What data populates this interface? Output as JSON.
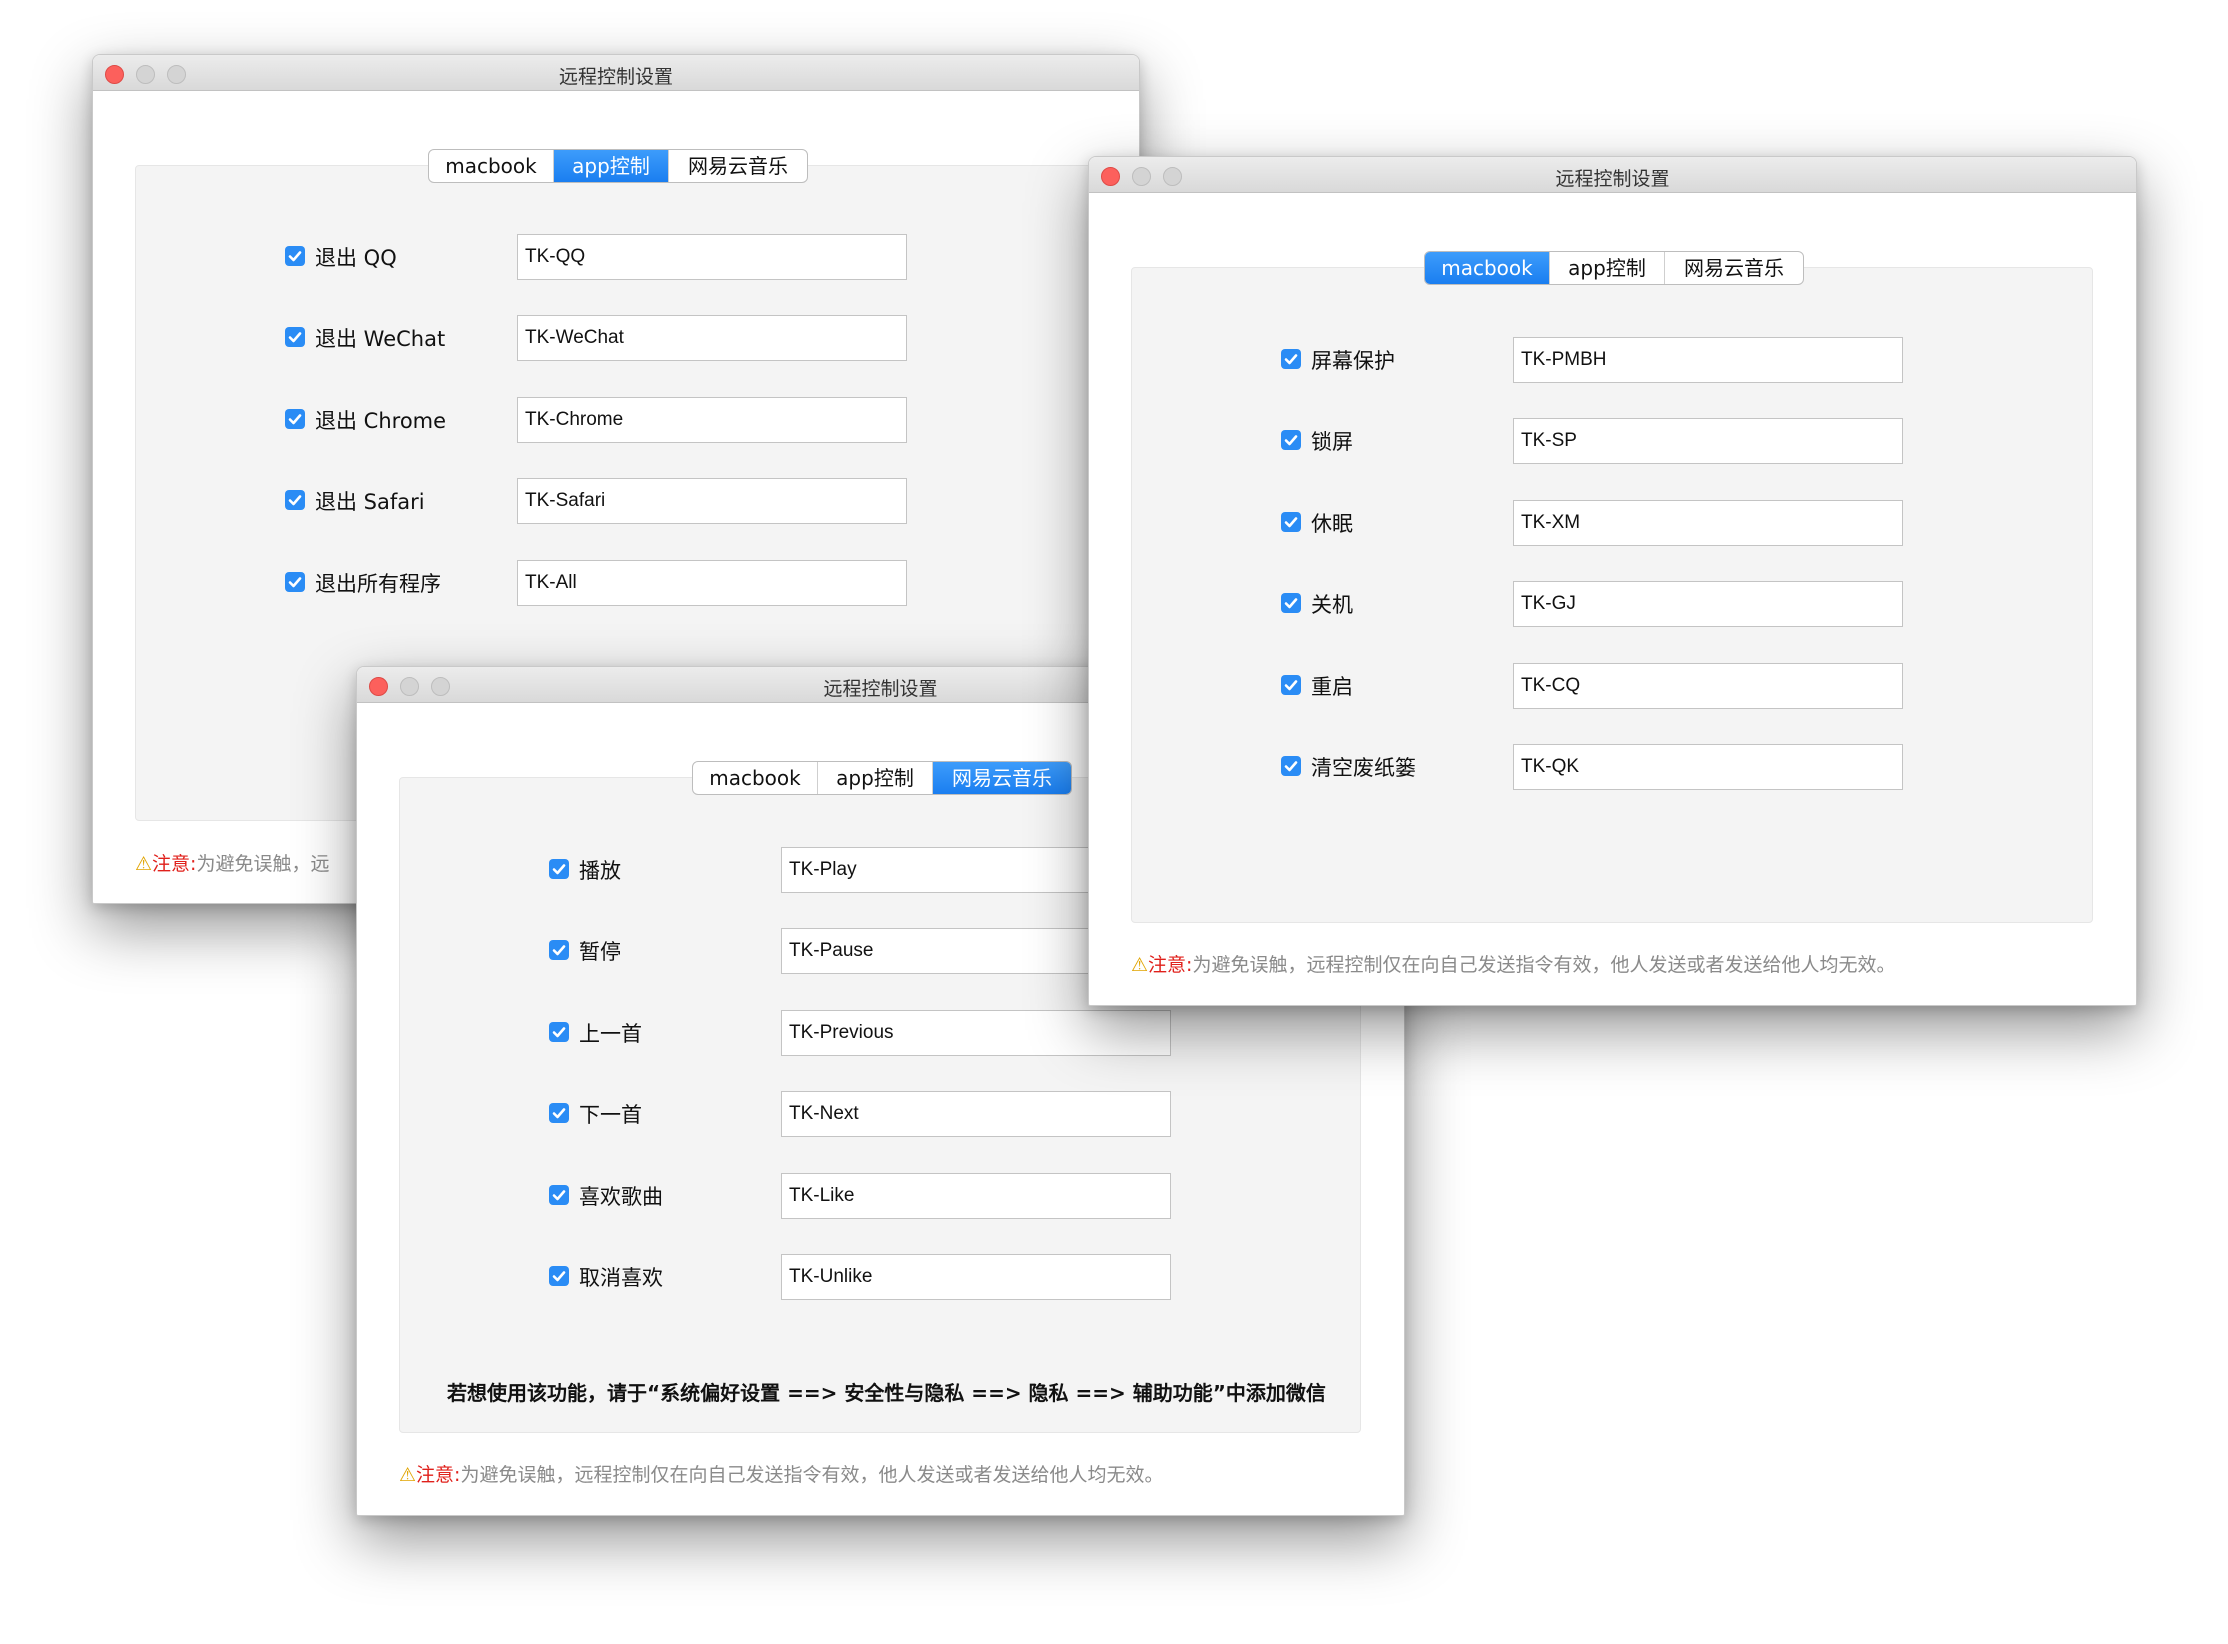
{
  "window_title": "远程控制设置",
  "tabs": [
    "macbook",
    "app控制",
    "网易云音乐"
  ],
  "app_window": {
    "active_tab": "app控制",
    "rows": [
      {
        "label": "退出 QQ",
        "value": "TK-QQ"
      },
      {
        "label": "退出 WeChat",
        "value": "TK-WeChat"
      },
      {
        "label": "退出 Chrome",
        "value": "TK-Chrome"
      },
      {
        "label": "退出 Safari",
        "value": "TK-Safari"
      },
      {
        "label": "退出所有程序",
        "value": "TK-All"
      }
    ],
    "note_prefix": "注意:",
    "note_text": "为避免误触，远"
  },
  "macbook_window": {
    "active_tab": "macbook",
    "rows": [
      {
        "label": "屏幕保护",
        "value": "TK-PMBH"
      },
      {
        "label": "锁屏",
        "value": "TK-SP"
      },
      {
        "label": "休眠",
        "value": "TK-XM"
      },
      {
        "label": "关机",
        "value": "TK-GJ"
      },
      {
        "label": "重启",
        "value": "TK-CQ"
      },
      {
        "label": "清空废纸篓",
        "value": "TK-QK"
      }
    ],
    "note_prefix": "注意:",
    "note_text": "为避免误触，远程控制仅在向自己发送指令有效，他人发送或者发送给他人均无效。"
  },
  "music_window": {
    "active_tab": "网易云音乐",
    "rows": [
      {
        "label": "播放",
        "value": "TK-Play"
      },
      {
        "label": "暂停",
        "value": "TK-Pause"
      },
      {
        "label": "上一首",
        "value": "TK-Previous"
      },
      {
        "label": "下一首",
        "value": "TK-Next"
      },
      {
        "label": "喜欢歌曲",
        "value": "TK-Like"
      },
      {
        "label": "取消喜欢",
        "value": "TK-Unlike"
      }
    ],
    "hint": "若想使用该功能，请于“系统偏好设置 ==> 安全性与隐私 ==> 隐私 ==> 辅助功能”中添加微信",
    "note_prefix": "注意:",
    "note_text": "为避免误触，远程控制仅在向自己发送指令有效，他人发送或者发送给他人均无效。"
  },
  "colors": {
    "accent": "#2a8cf5",
    "warning_red": "#e0201b",
    "note_gray": "#8a8a8a",
    "close_button": "#fc605c"
  }
}
